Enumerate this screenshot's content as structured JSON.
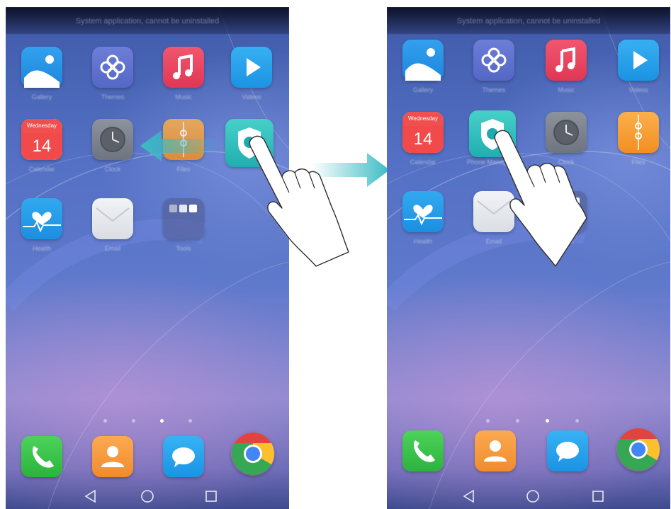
{
  "toast": "System application, cannot be uninstalled",
  "apps": {
    "gallery": "Gallery",
    "themes": "Themes",
    "music": "Music",
    "videos": "Videos",
    "calendar": "Calendar",
    "clock": "Clock",
    "files": "Files",
    "phone_manager": "Phone Manager",
    "health": "Health",
    "email": "Email",
    "tools": "Tools"
  },
  "calendar": {
    "weekday": "Wednesday",
    "day": "14"
  },
  "page_indicator": {
    "pages": 4,
    "current": 3
  },
  "icons": {
    "dock": [
      "phone-icon",
      "contacts-icon",
      "messaging-icon",
      "chrome-icon"
    ],
    "nav": [
      "back-icon",
      "home-icon",
      "recents-icon"
    ]
  },
  "colors": {
    "transition_arrow": "#3bbcc4",
    "drag_arrow": "#3bbcc4",
    "wallpaper": "#5470c4"
  }
}
